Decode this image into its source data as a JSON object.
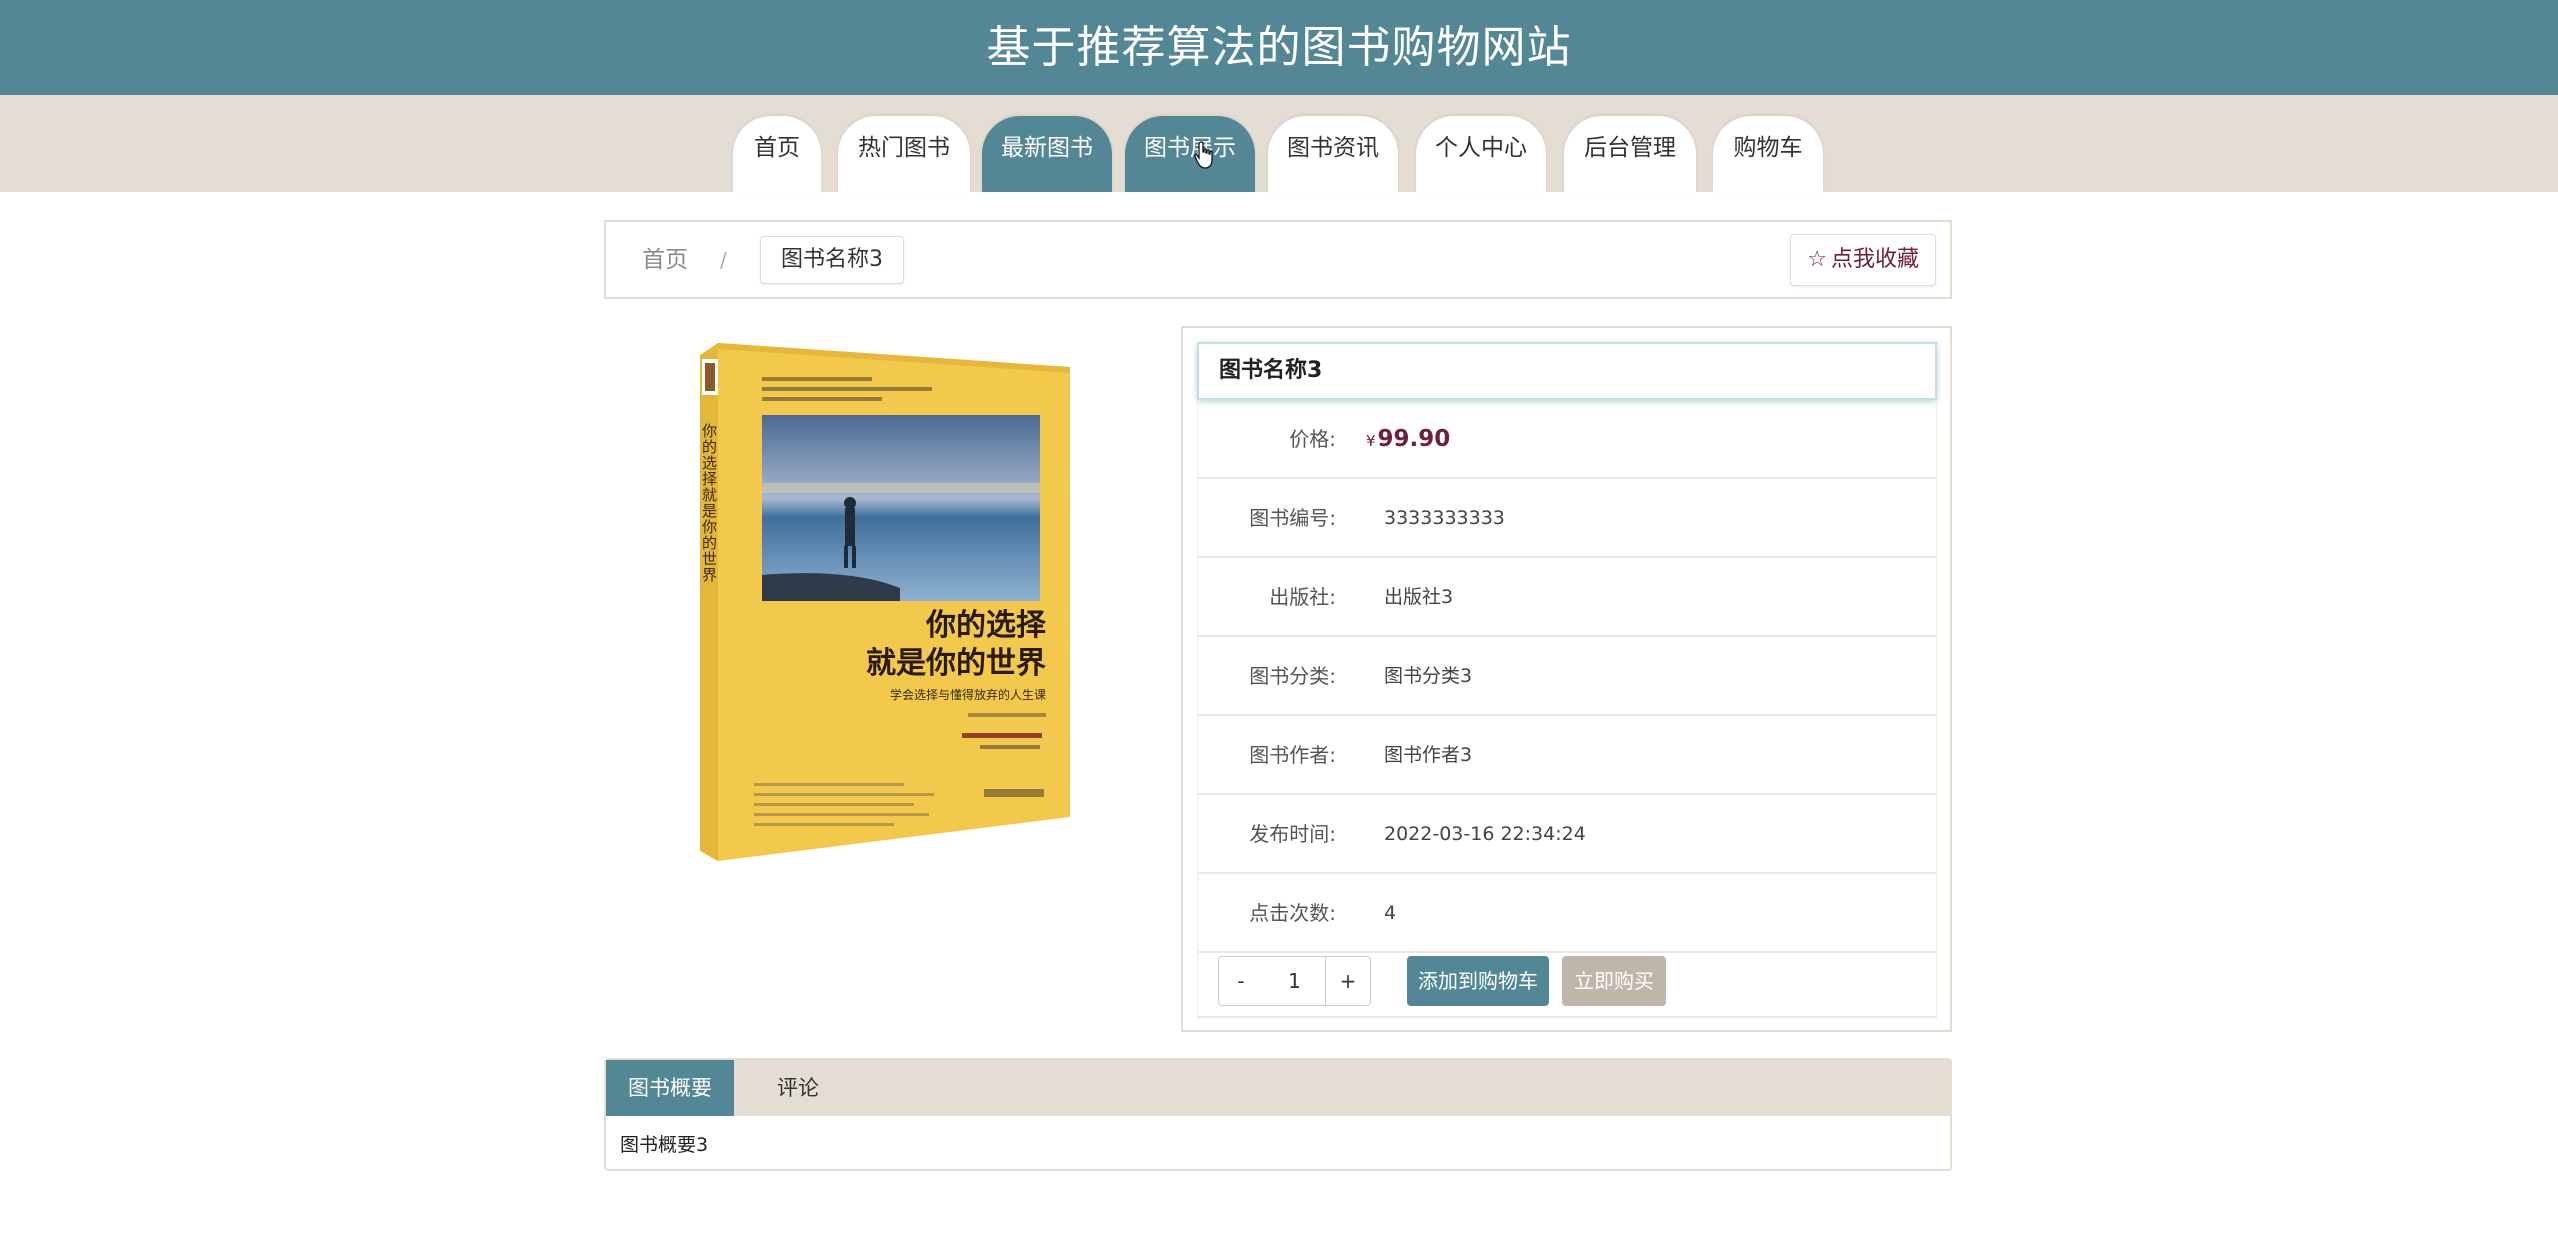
{
  "header": {
    "title": "基于推荐算法的图书购物网站"
  },
  "nav": {
    "items": [
      {
        "label": "首页",
        "active": false
      },
      {
        "label": "热门图书",
        "active": false
      },
      {
        "label": "最新图书",
        "active": true
      },
      {
        "label": "图书展示",
        "active": true
      },
      {
        "label": "图书资讯",
        "active": false
      },
      {
        "label": "个人中心",
        "active": false
      },
      {
        "label": "后台管理",
        "active": false
      },
      {
        "label": "购物车",
        "active": false
      }
    ]
  },
  "breadcrumb": {
    "home": "首页",
    "separator": "/",
    "current": "图书名称3"
  },
  "favorite": {
    "icon": "star-outline-icon",
    "label": "点我收藏"
  },
  "book_cover": {
    "spine_title": "你的选择就是你的世界",
    "title_line1": "你的选择",
    "title_line2": "就是你的世界",
    "subtitle": "学会选择与懂得放弃的人生课"
  },
  "book": {
    "title": "图书名称3",
    "price_label": "价格:",
    "currency": "¥",
    "price": "99.90",
    "fields": [
      {
        "label": "图书编号:",
        "value": "3333333333"
      },
      {
        "label": "出版社:",
        "value": "出版社3"
      },
      {
        "label": "图书分类:",
        "value": "图书分类3"
      },
      {
        "label": "图书作者:",
        "value": "图书作者3"
      },
      {
        "label": "发布时间:",
        "value": "2022-03-16 22:34:24"
      },
      {
        "label": "点击次数:",
        "value": "4"
      }
    ]
  },
  "actions": {
    "minus": "-",
    "quantity": "1",
    "plus": "+",
    "add_to_cart": "添加到购物车",
    "buy_now": "立即购买"
  },
  "tabs": {
    "items": [
      {
        "label": "图书概要",
        "active": true
      },
      {
        "label": "评论",
        "active": false
      }
    ],
    "content": "图书概要3"
  },
  "colors": {
    "primary": "#538795",
    "beige": "#e4ddd3",
    "price": "#6e1f3a",
    "buy_button": "#bfb5a8"
  }
}
